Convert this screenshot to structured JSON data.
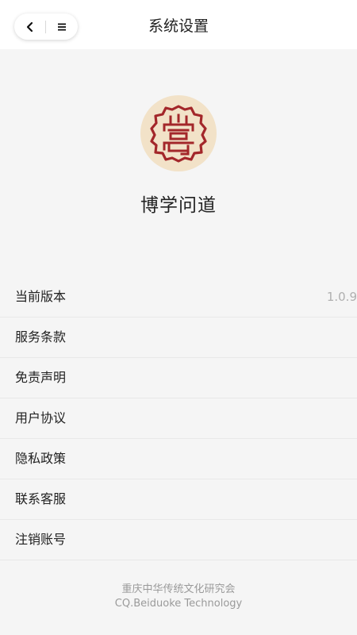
{
  "header": {
    "title": "系统设置"
  },
  "app": {
    "name": "博学问道"
  },
  "menu": {
    "items": [
      {
        "label": "当前版本",
        "value": "1.0.9"
      },
      {
        "label": "服务条款"
      },
      {
        "label": "免责声明"
      },
      {
        "label": "用户协议"
      },
      {
        "label": "隐私政策"
      },
      {
        "label": "联系客服"
      },
      {
        "label": "注销账号"
      }
    ]
  },
  "footer": {
    "line1": "重庆中华传统文化研究会",
    "line2": "CQ.Beiduoke Technology"
  },
  "colors": {
    "logo_red": "#a3272a",
    "logo_bg": "#f2e2c8"
  }
}
